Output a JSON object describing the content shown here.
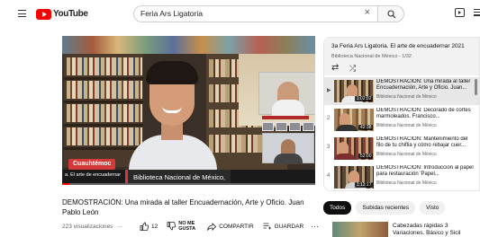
{
  "header": {
    "logo_text": "YouTube",
    "search_query": "Feria Ars Ligatoria"
  },
  "player": {
    "name_badge": "Cuauhtémoc",
    "hashtag": "a. El arte de encuadernar",
    "institution": "Biblioteca Nacional de México,"
  },
  "video": {
    "title": "DEMOSTRACIÓN: Una mirada al taller Encuadernación, Arte y Oficio. Juan Pablo León",
    "views": "223 visualizaciones",
    "views_more": "...",
    "likes": "12",
    "dislike_label": "NO ME GUSTA",
    "share_label": "COMPARTIR",
    "save_label": "GUARDAR",
    "more": "···"
  },
  "playlist": {
    "title": "3a Feria Ars Ligatoria. El arte de encuadernar 2021",
    "subtitle": "Biblioteca Nacional de México - 1/32",
    "items": [
      {
        "index": "▶",
        "title": "DEMOSTRACIÓN: Una mirada al taller Encuadernación, Arte y Oficio. Juan...",
        "channel": "Biblioteca Nacional de México",
        "duration": "1:02:02"
      },
      {
        "index": "2",
        "title": "DEMOSTRACIÓN: Decorado de cortes marmoleados. Francisco...",
        "channel": "Biblioteca Nacional de México",
        "duration": "42:38"
      },
      {
        "index": "3",
        "title": "DEMOSTRACIÓN: Mantenimiento del filo de tu chiflia y cómo rebajar cuer...",
        "channel": "Biblioteca Nacional de México",
        "duration": "52:00"
      },
      {
        "index": "4",
        "title": "DEMOSTRACIÓN: Introducción al papel para restauración 'Papel...",
        "channel": "Biblioteca Nacional de México",
        "duration": "1:13:17"
      }
    ]
  },
  "chips": [
    "Todos",
    "Subidas recientes",
    "Visto"
  ],
  "recommendation": {
    "title": "Cabezadas rápidas 3 Variaciones. Básico y Sicil"
  },
  "colors": {
    "brand_red": "#ff0000",
    "badge_red": "#d53a3a",
    "chip_selected": "#0f0f0f"
  }
}
